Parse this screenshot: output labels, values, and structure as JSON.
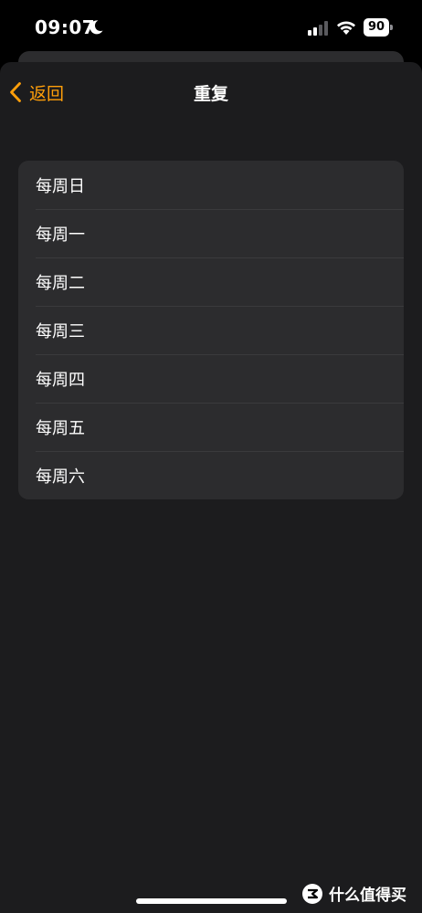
{
  "status_bar": {
    "time": "09:07",
    "battery_level": "90"
  },
  "nav": {
    "back_label": "返回",
    "title": "重复"
  },
  "repeat_options": [
    {
      "label": "每周日"
    },
    {
      "label": "每周一"
    },
    {
      "label": "每周二"
    },
    {
      "label": "每周三"
    },
    {
      "label": "每周四"
    },
    {
      "label": "每周五"
    },
    {
      "label": "每周六"
    }
  ],
  "watermark": {
    "text": "什么值得买"
  },
  "colors": {
    "accent": "#ff9f0a",
    "sheet_background": "#1c1c1e",
    "list_background": "#2c2c2e",
    "separator": "#3a3a3c"
  }
}
